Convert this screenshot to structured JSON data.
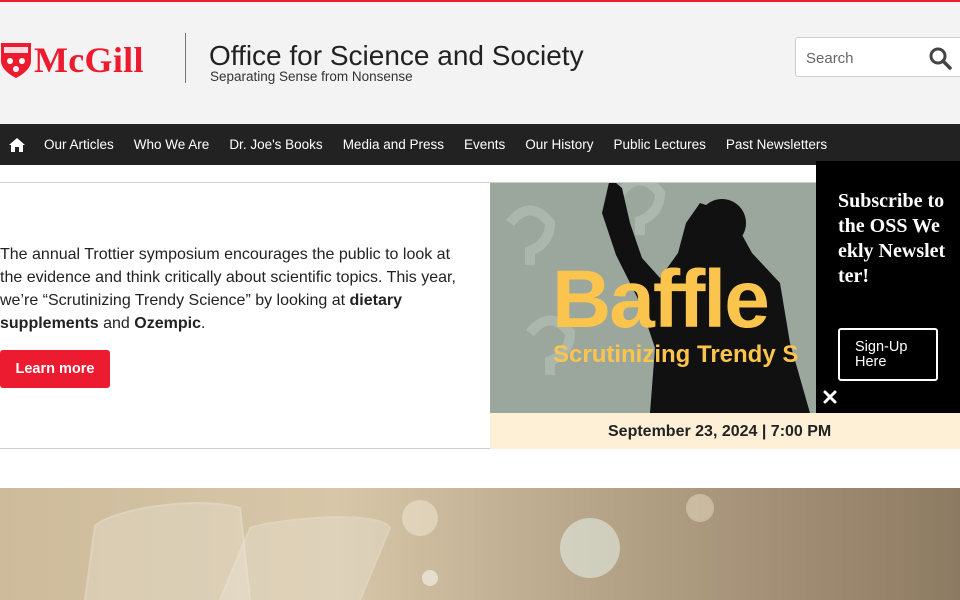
{
  "header": {
    "logo_text": "McGill",
    "site_title": "Office for Science and Society",
    "tagline": "Separating Sense from Nonsense",
    "search_placeholder": "Search"
  },
  "nav": {
    "items": [
      {
        "label": "Our Articles"
      },
      {
        "label": "Who We Are"
      },
      {
        "label": "Dr. Joe's Books"
      },
      {
        "label": "Media and Press"
      },
      {
        "label": "Events"
      },
      {
        "label": "Our History"
      },
      {
        "label": "Public Lectures"
      },
      {
        "label": "Past Newsletters"
      }
    ]
  },
  "hero": {
    "text_1": "The annual Trottier symposium encourages the public to look at the evidence and think critically about scientific topics. This year, we’re “Scrutinizing Trendy Science” by looking at ",
    "bold_1": "dietary supplements",
    "text_2": " and ",
    "bold_2": "Ozempic",
    "text_3": ".",
    "button_label": "Learn more",
    "banner_title": "Baffle",
    "banner_subtitle": "Scrutinizing Trendy S",
    "banner_date": "September 23, 2024 | 7:00 PM"
  },
  "popup": {
    "title": "Subscribe to the OSS Weekly Newsletter!",
    "button_label": "Sign-Up Here"
  },
  "colors": {
    "accent": "#ed1b2f",
    "nav_bg": "#222222",
    "banner_yellow": "#fbc54d"
  },
  "icons": {
    "home": "home-icon",
    "search": "search-icon",
    "close": "close-icon"
  }
}
